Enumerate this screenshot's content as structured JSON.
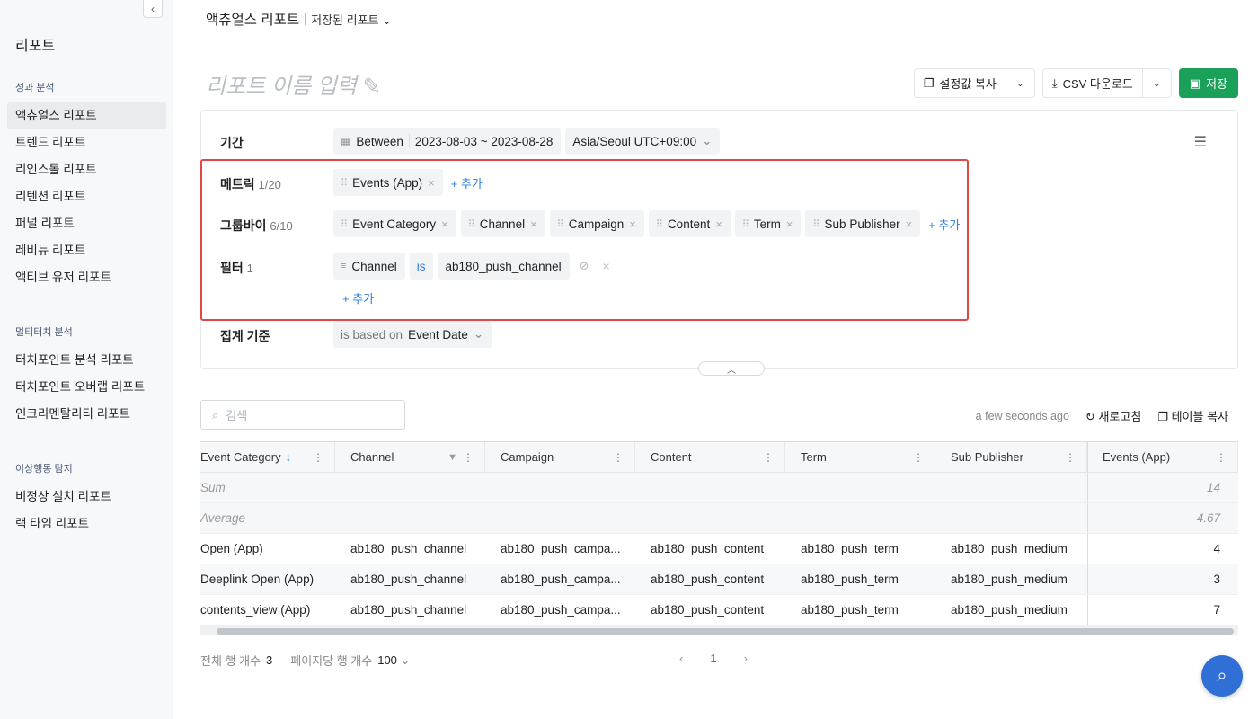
{
  "sidebar": {
    "collapse_icon": "‹",
    "title": "리포트",
    "groups": [
      {
        "label": "성과 분석",
        "items": [
          "액츄얼스 리포트",
          "트렌드 리포트",
          "리인스톨 리포트",
          "리텐션 리포트",
          "퍼널 리포트",
          "레비뉴 리포트",
          "액티브 유저 리포트"
        ]
      },
      {
        "label": "멀티터치 분석",
        "items": [
          "터치포인트 분석 리포트",
          "터치포인트 오버랩 리포트",
          "인크리멘탈리티 리포트"
        ]
      },
      {
        "label": "이상행동 탐지",
        "items": [
          "비정상 설치 리포트",
          "랙 타임 리포트"
        ]
      }
    ],
    "active_item": "액츄얼스 리포트"
  },
  "topbar": {
    "crumb": "액츄얼스 리포트",
    "saved": "저장된 리포트"
  },
  "report_name_placeholder": "리포트 이름 입력",
  "actions": {
    "copy_settings": "설정값 복사",
    "csv_download": "CSV 다운로드",
    "save": "저장"
  },
  "period": {
    "label": "기간",
    "mode": "Between",
    "range": "2023-08-03 ~ 2023-08-28",
    "timezone": "Asia/Seoul UTC+09:00"
  },
  "metrics": {
    "label": "메트릭",
    "count": "1/20",
    "chips": [
      "Events (App)"
    ],
    "add": "+ 추가"
  },
  "groupby": {
    "label": "그룹바이",
    "count": "6/10",
    "chips": [
      "Event Category",
      "Channel",
      "Campaign",
      "Content",
      "Term",
      "Sub Publisher"
    ],
    "add": "+ 추가"
  },
  "filter": {
    "label": "필터",
    "count": "1",
    "field": "Channel",
    "op": "is",
    "value": "ab180_push_channel",
    "add": "+ 추가"
  },
  "aggregation": {
    "label": "집계 기준",
    "prefix": "is based on",
    "value": "Event Date"
  },
  "table_tools": {
    "search_placeholder": "검색",
    "updated": "a few seconds ago",
    "refresh": "새로고침",
    "copy_table": "테이블 복사"
  },
  "table": {
    "columns": [
      "Event Category",
      "Channel",
      "Campaign",
      "Content",
      "Term",
      "Sub Publisher",
      "Events (App)"
    ],
    "sum": {
      "label": "Sum",
      "value": "14"
    },
    "average": {
      "label": "Average",
      "value": "4.67"
    },
    "rows": [
      [
        "Open (App)",
        "ab180_push_channel",
        "ab180_push_campa...",
        "ab180_push_content",
        "ab180_push_term",
        "ab180_push_medium",
        "4"
      ],
      [
        "Deeplink Open (App)",
        "ab180_push_channel",
        "ab180_push_campa...",
        "ab180_push_content",
        "ab180_push_term",
        "ab180_push_medium",
        "3"
      ],
      [
        "contents_view (App)",
        "ab180_push_channel",
        "ab180_push_campa...",
        "ab180_push_content",
        "ab180_push_term",
        "ab180_push_medium",
        "7"
      ]
    ]
  },
  "footer": {
    "total_label": "전체 행 개수",
    "total": "3",
    "per_page_label": "페이지당 행 개수",
    "per_page": "100",
    "page": "1"
  },
  "colors": {
    "accent": "#2f7de1",
    "save_green": "#1ba05a",
    "highlight_red": "#e04848"
  }
}
